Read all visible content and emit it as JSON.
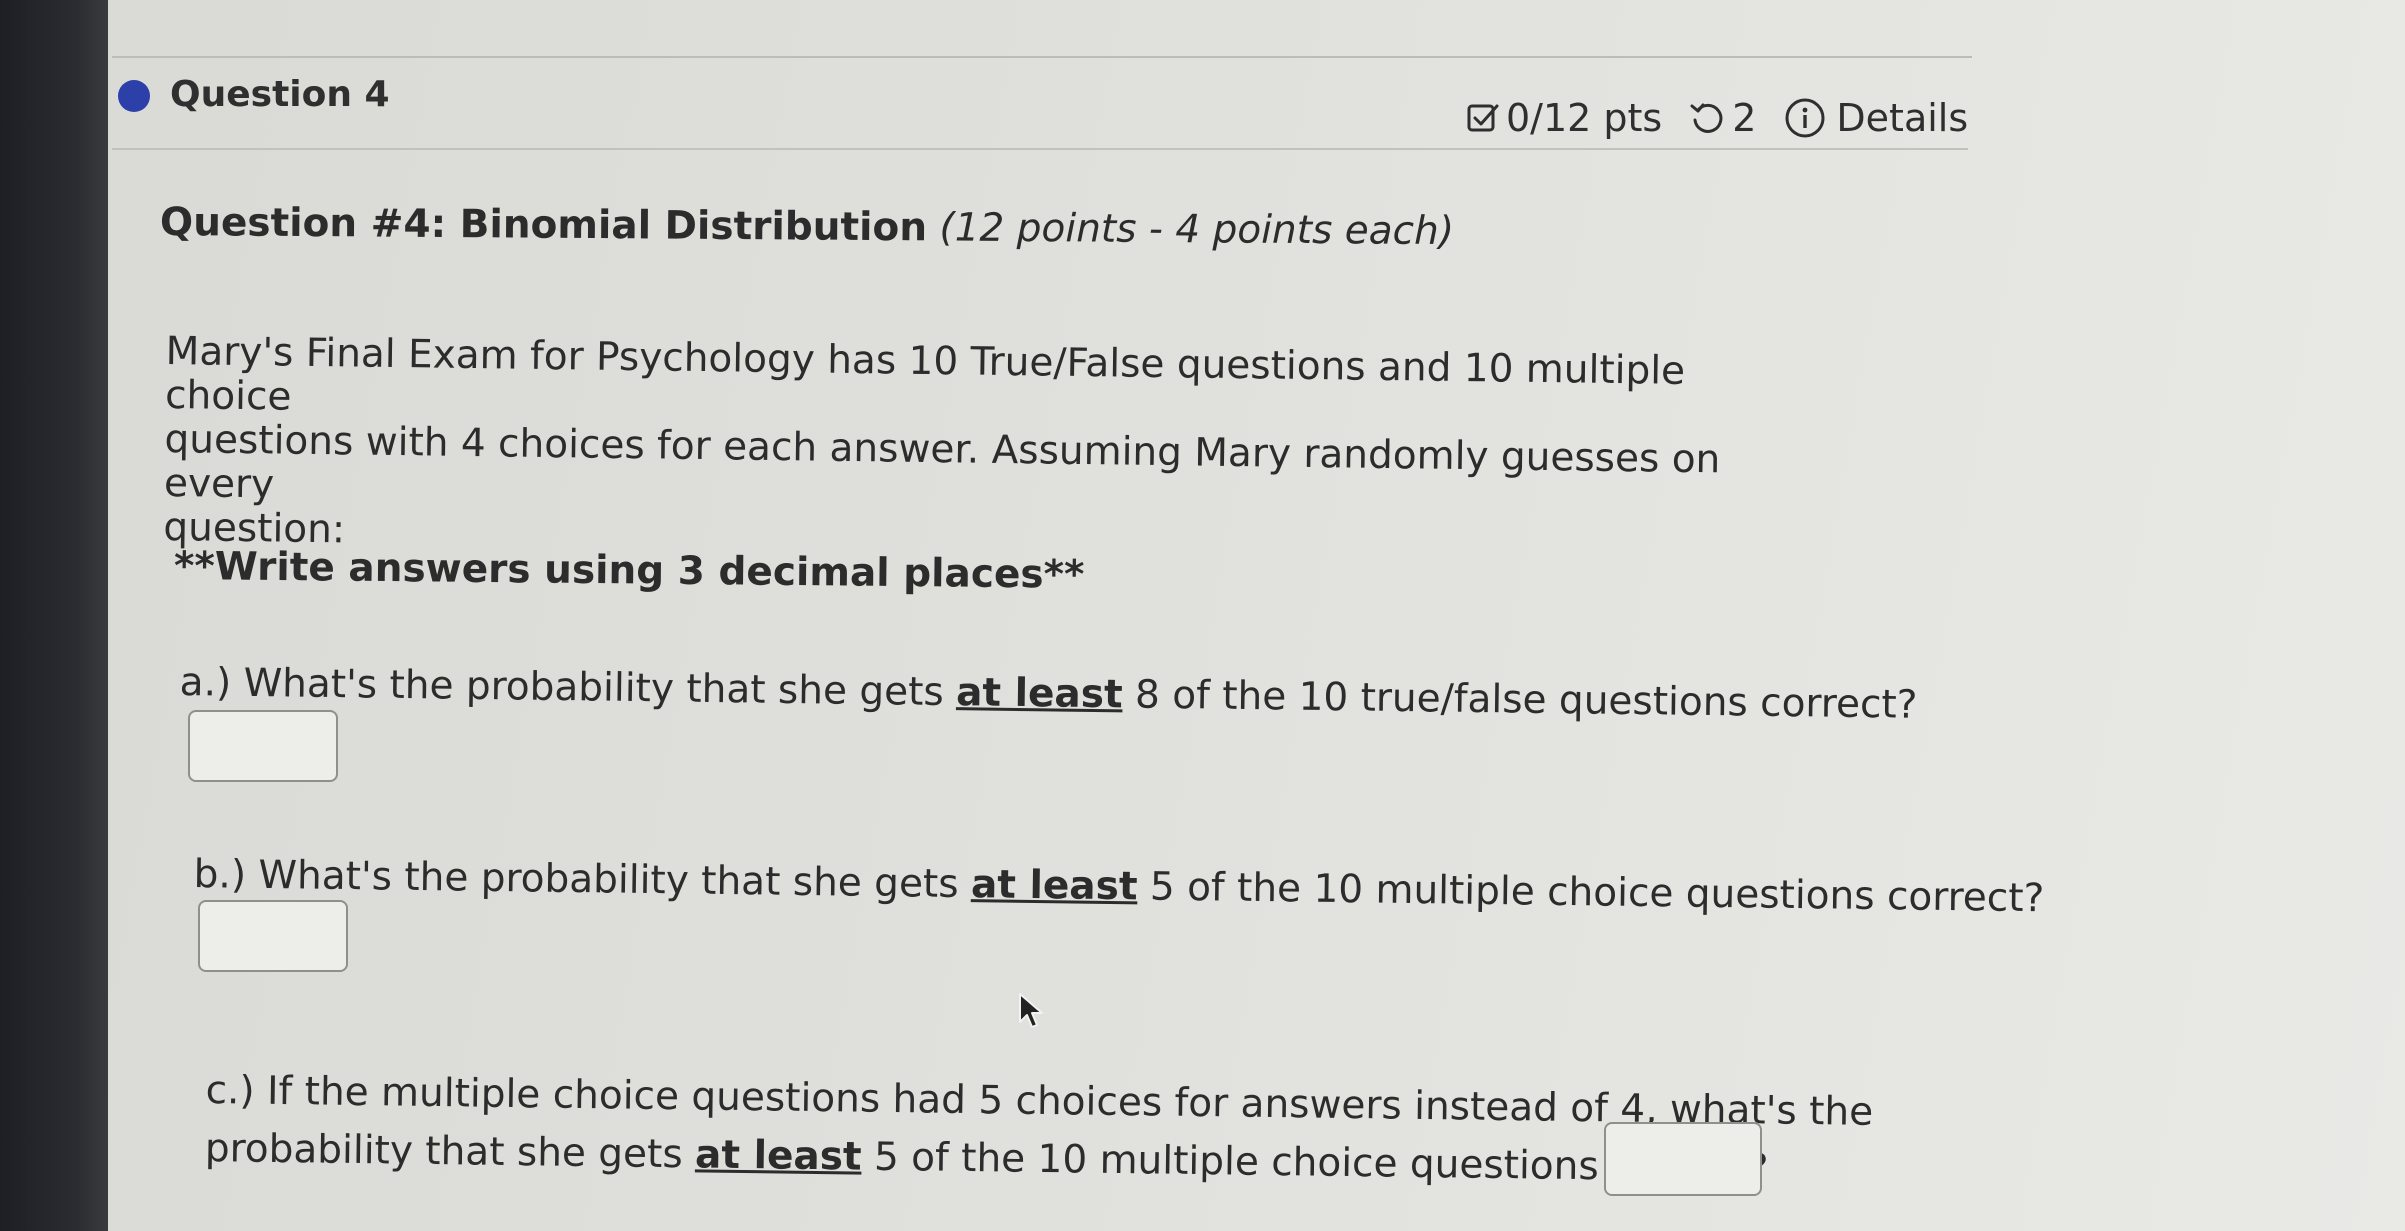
{
  "header": {
    "question_label": "Question 4",
    "score": "0/12 pts",
    "attempts": "2",
    "details_label": "Details"
  },
  "icons": {
    "status": "status-dot-icon",
    "score": "checkbox-icon",
    "attempts": "retry-icon",
    "details": "info-icon",
    "cursor": "mouse-pointer-icon"
  },
  "colors": {
    "status_dot": "#2d3fa8"
  },
  "question": {
    "title_bold": "Question #4: Binomial Distribution",
    "title_italic": "(12 points - 4 points each)",
    "intro_lines": [
      "Mary's Final Exam for Psychology has 10 True/False questions and 10 multiple choice",
      "questions with 4 choices for each answer. Assuming Mary randomly guesses on every",
      "question:"
    ],
    "instructions": "**Write answers using 3 decimal places**"
  },
  "parts": {
    "a": {
      "prefix": "a.) What's the probability that she gets ",
      "emphasis": "at least",
      "suffix": " 8 of the 10 true/false questions correct?",
      "answer_value": ""
    },
    "b": {
      "prefix": "b.) What's the probability that she gets ",
      "emphasis": "at least",
      "suffix": " 5 of the 10 multiple choice questions correct?",
      "answer_value": ""
    },
    "c": {
      "line1": "c.) If the multiple choice questions had 5 choices for answers instead of 4, what's the",
      "prefix": "probability that she gets ",
      "emphasis": "at least",
      "suffix": " 5 of the 10 multiple choice questions correct?",
      "answer_value": ""
    }
  }
}
